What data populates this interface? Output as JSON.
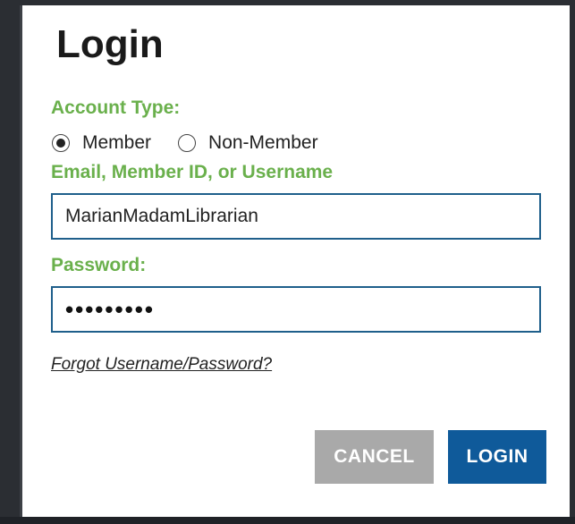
{
  "dialog": {
    "title": "Login",
    "account_type_label": "Account Type:",
    "account_types": [
      {
        "label": "Member",
        "selected": true
      },
      {
        "label": "Non-Member",
        "selected": false
      }
    ],
    "username_label": "Email, Member ID, or Username",
    "username_value": "MarianMadamLibrarian",
    "password_label": "Password:",
    "password_mask": "•••••••••",
    "forgot_link": "Forgot Username/Password?",
    "cancel_label": "CANCEL",
    "login_label": "LOGIN"
  },
  "colors": {
    "label_green": "#6ab04c",
    "input_border": "#1f5f8b",
    "login_button": "#0f5a9a",
    "cancel_button": "#a9a9a9"
  }
}
